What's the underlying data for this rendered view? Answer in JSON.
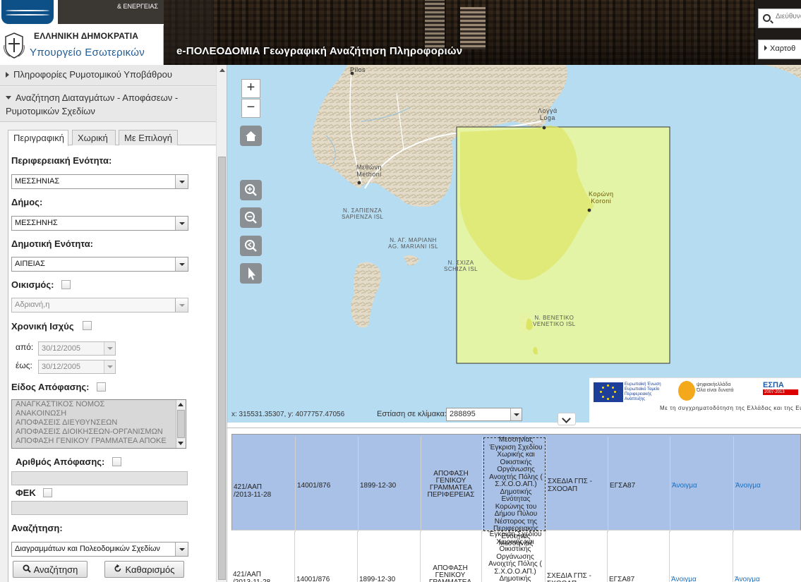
{
  "header": {
    "eu_subtitle": "& ΕΝΕΡΓΕΙΑΣ",
    "ministry_line1": "ΕΛΛΗΝΙΚΗ ΔΗΜΟΚΡΑΤΙΑ",
    "ministry_line2": "Υπουργείο Εσωτερικών",
    "app_title": "e-ΠΟΛΕΟΔΟΜΙΑ Γεωγραφική Αναζήτηση Πληροφοριών",
    "address_placeholder": "Διεύθυνση",
    "maps_button": "Χαρτοθ"
  },
  "left_panel": {
    "accordion_1": "Πληροφορίες Ρυμοτομικού Υποβάθρου",
    "accordion_2_line1": "Αναζήτηση Διαταγμάτων - Αποφάσεων -",
    "accordion_2_line2": "Ρυμοτομικών Σχεδίων",
    "tabs": [
      {
        "label": "Περιγραφική",
        "active": true
      },
      {
        "label": "Χωρική",
        "active": false
      },
      {
        "label": "Με Επιλογή",
        "active": false
      }
    ],
    "regional_unit": {
      "label": "Περιφερειακή Ενότητα:",
      "value": "ΜΕΣΣΗΝΙΑΣ"
    },
    "municipality": {
      "label": "Δήμος:",
      "value": "ΜΕΣΣΗΝΗΣ"
    },
    "municipal_unit": {
      "label": "Δημοτική Ενότητα:",
      "value": "ΑΙΠΕΙΑΣ"
    },
    "settlement": {
      "label": "Οικισμός:",
      "value": "Αδριανή,η"
    },
    "validity": {
      "label": "Χρονική Ισχύς",
      "from_label": "από:",
      "from_value": "30/12/2005",
      "to_label": "έως:",
      "to_value": "30/12/2005"
    },
    "decision_type": {
      "label": "Είδος Απόφασης:",
      "options": [
        "ΑΝΑΓΚΑΣΤΙΚΟΣ ΝΟΜΟΣ",
        "ΑΝΑΚΟΙΝΩΣΗ",
        "ΑΠΟΦΑΣΕΙΣ ΔΙΕΥΘΥΝΣΕΩΝ",
        "ΑΠΟΦΑΣΕΙΣ ΔΙΟΙΚΗΣΕΩΝ-ΟΡΓΑΝΙΣΜΩΝ",
        "ΑΠΟΦΑΣΗ ΓΕΝΙΚΟΥ ΓΡΑΜΜΑΤΕΑ ΑΠΟΚΕ"
      ]
    },
    "decision_number": {
      "label": "Αριθμός Απόφασης:"
    },
    "fek": {
      "label": "ΦΕΚ"
    },
    "search_in": {
      "label": "Αναζήτηση:",
      "value": "Διαγραμμάτων και Πολεοδομικών Σχεδίων"
    },
    "search_button": "Αναζήτηση",
    "clear_button": "Καθαρισμός"
  },
  "map": {
    "zoom_in": "+",
    "zoom_out": "−",
    "labels": {
      "pilos": "Pilos",
      "logi": "Λογγά\nLoga",
      "methoni": "Μεθώνη\nMethoni",
      "koroni": "Κορώνη\nKoroni",
      "sapienza": "Ν. ΣΑΠΙΕΝΖΑ\nSAPIENZA ISL",
      "mariani": "Ν. ΑΓ. ΜΑΡΙΑΝΗ\nAG. MARIANI ISL",
      "schiza": "Ν. ΣΧΙΖΑ\nSCHIZA ISL",
      "venetiko": "Ν. ΒΕΝΕΤΙΚΟ\nVENETIKO ISL"
    },
    "coords_text": "x: 315531.35307, y: 4077757.47056",
    "scale_label": "Εστίαση σε κλίμακα:",
    "scale_value": "288895",
    "logos": {
      "eu_text": "Ευρωπαϊκή Ένωση\nΕυρωπαϊκό Ταμείο\nΠεριφερειακής\nΑνάπτυξης",
      "digital_text": "ψηφιακήελλάδα\nΌλα είναι δυνατά",
      "espa_title": "ΕΣΠΑ",
      "espa_years": "2007-2013",
      "cofund_text": "Με τη συγχρηματοδότηση της Ελλάδας και της Ευ"
    },
    "colors": {
      "sea": "#b6dcf2",
      "land": "#e8e0d0",
      "selection_fill": "#e8f5a0",
      "selection_stroke": "#333333"
    }
  },
  "results": {
    "rows": [
      {
        "selected": true,
        "decision": "421/ΑΑΠ\n/2013-11-28",
        "protocol": "14001/876",
        "date": "1899-12-30",
        "type": "ΑΠΟΦΑΣΗ\nΓΕΝΙΚΟΥ\nΓΡΑΜΜΑΤΕΑ\nΠΕΡΙΦΕΡΕΙΑΣ",
        "description": "Μεσσηνίας\nΈγκριση Σχεδίου\nΧωρικής και\nΟικιστικής\nΟργάνωσης\nΑνοιχτής Πόλης (\nΣ.Χ.Ο.Ο.ΑΠ.)\nΔημοτικής\nΕνότητας\nΚορώνης του\nΔήμου Πύλου\nΝέστορος της\nΠεριφερειακής\nΕνότητας\nΜεσσηνίας",
        "plan": "ΣΧΕΔΙΑ ΓΠΣ -\nΣΧΟΟΑΠ",
        "datum": "ΕΓΣΑ87",
        "open1": "Άνοιγμα",
        "open2": "Άνοιγμα"
      },
      {
        "selected": false,
        "decision": "421/ΑΑΠ\n/2013-11-28",
        "protocol": "14001/876",
        "date": "1899-12-30",
        "type": "ΑΠΟΦΑΣΗ\nΓΕΝΙΚΟΥ\nΓΡΑΜΜΑΤΕΑ",
        "description": "Έγκριση Σχεδίου\nΧωρικής και\nΟικιστικής\nΟργάνωσης\nΑνοιχτής Πόλης (\nΣ.Χ.Ο.Ο.ΑΠ.)\nΔημοτικής\nΕνότητας",
        "plan": "ΣΧΕΔΙΑ ΓΠΣ -\nΣΧΟΟΑΠ",
        "datum": "ΕΓΣΑ87",
        "open1": "Άνοιγμα",
        "open2": "Άνοιγμα"
      }
    ]
  }
}
